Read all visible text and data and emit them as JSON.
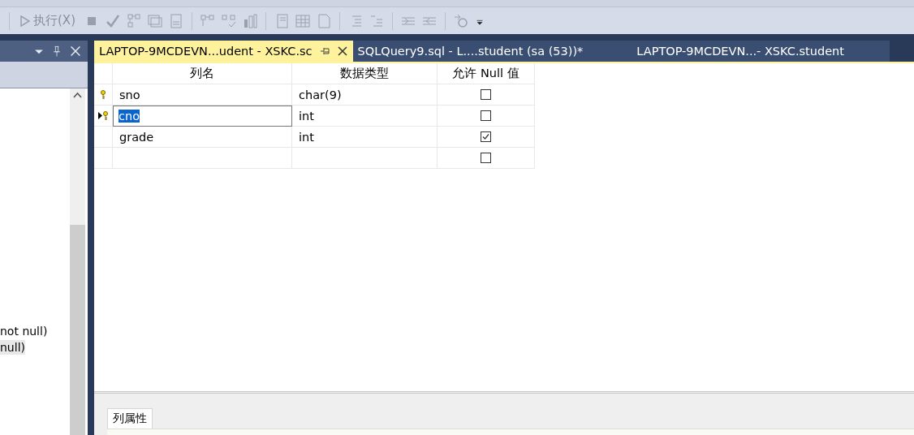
{
  "toolbar": {
    "execute_label": "执行(X)"
  },
  "left_panel": {
    "lines": [
      {
        "text": "not null)",
        "selected": false
      },
      {
        "text": "null)",
        "selected": true
      }
    ]
  },
  "tabs": [
    {
      "label": "LAPTOP-9MCDEVN...udent - XSKC.sc",
      "selected": true
    },
    {
      "label": "SQLQuery9.sql - L....student (sa (53))*",
      "selected": false
    },
    {
      "label": "LAPTOP-9MCDEVN...- XSKC.student",
      "selected": false
    }
  ],
  "grid": {
    "columns": [
      "列名",
      "数据类型",
      "允许 Null 值"
    ],
    "rows": [
      {
        "name": "sno",
        "type": "char(9)",
        "allow_null": false,
        "primary_key": true,
        "current": false,
        "editing": false
      },
      {
        "name": "cno",
        "type": "int",
        "allow_null": false,
        "primary_key": true,
        "current": true,
        "editing": true
      },
      {
        "name": "grade",
        "type": "int",
        "allow_null": true,
        "primary_key": false,
        "current": false,
        "editing": false
      },
      {
        "name": "",
        "type": "",
        "allow_null": false,
        "primary_key": false,
        "current": false,
        "editing": false
      }
    ]
  },
  "properties": {
    "tab": "列属性"
  }
}
